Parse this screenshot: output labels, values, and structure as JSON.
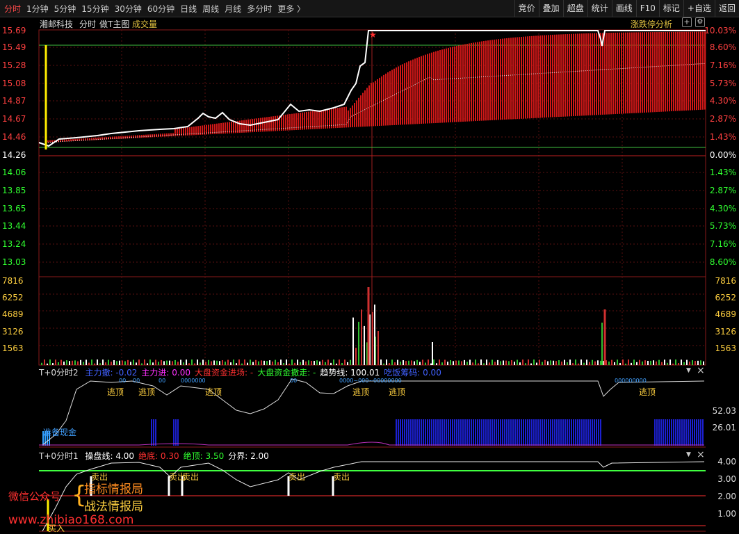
{
  "toolbar": {
    "left": [
      {
        "label": "分时",
        "active": true
      },
      {
        "label": "1分钟"
      },
      {
        "label": "5分钟"
      },
      {
        "label": "15分钟"
      },
      {
        "label": "30分钟"
      },
      {
        "label": "60分钟"
      },
      {
        "label": "日线"
      },
      {
        "label": "周线"
      },
      {
        "label": "月线"
      },
      {
        "label": "多分时"
      },
      {
        "label": "更多 〉"
      }
    ],
    "right": [
      "竞价",
      "叠加",
      "超盘",
      "统计",
      "画线",
      "F10",
      "标记",
      "+自选",
      "返回"
    ]
  },
  "chart_header": {
    "stock_name": "湘邮科技",
    "mode": "分时",
    "template": "做T主图",
    "volume": "成交量",
    "limit_analysis": "涨跌停分析",
    "plus_icon": "+",
    "settings_icon": "⚙"
  },
  "price_axis": {
    "left": [
      "15.69",
      "15.49",
      "15.28",
      "15.08",
      "14.87",
      "14.67",
      "14.46",
      "14.26",
      "14.06",
      "13.85",
      "13.65",
      "13.44",
      "13.24",
      "13.03"
    ],
    "right": [
      "10.03%",
      "8.60%",
      "7.16%",
      "5.73%",
      "4.30%",
      "2.87%",
      "1.43%",
      "0.00%",
      "1.43%",
      "2.87%",
      "4.30%",
      "5.73%",
      "7.16%",
      "8.60%"
    ],
    "up_color": "#ff4040",
    "base_color": "#ffffff",
    "down_color": "#30ff30"
  },
  "volume_axis": {
    "labels": [
      "7816",
      "6252",
      "4689",
      "3126",
      "1563"
    ],
    "color": "#ffd040"
  },
  "indicator2": {
    "title": "T+0分时2",
    "items": [
      {
        "text": "主力撤: -0.02",
        "color": "#4060ff"
      },
      {
        "text": "主力进: 0.00",
        "color": "#ff30ff"
      },
      {
        "text": "大盘资金进场: -",
        "color": "#ff3030"
      },
      {
        "text": "大盘资金撤走: -",
        "color": "#30ff30"
      },
      {
        "text": "趋势线: 100.01",
        "color": "#ffffff"
      },
      {
        "text": "吃饭筹码: 0.00",
        "color": "#4060ff"
      }
    ],
    "axis": [
      "52.03",
      "26.01"
    ],
    "signals": [
      "逃顶",
      "逃顶",
      "逃顶",
      "逃顶",
      "逃顶",
      "逃顶"
    ],
    "cash_label": "准备现金",
    "markers": [
      "00",
      "00",
      "00",
      "0000000",
      "00",
      "0000~000~00000000",
      "000000000"
    ]
  },
  "indicator1": {
    "title": "T+0分时1",
    "items": [
      {
        "text": "操盘线: 4.00",
        "color": "#ffffff"
      },
      {
        "text": "绝底: 0.30",
        "color": "#ff3030"
      },
      {
        "text": "绝顶: 3.50",
        "color": "#30ff30"
      },
      {
        "text": "分界: 2.00",
        "color": "#ffffff"
      }
    ],
    "axis": [
      "4.00",
      "3.00",
      "2.00",
      "1.00"
    ],
    "signals": [
      "卖出",
      "卖出",
      "卖出",
      "卖出",
      "卖出"
    ],
    "buy_label": "买入"
  },
  "watermark": {
    "line1": "微信公众号",
    "brace": "{",
    "line2a": "指标情报局",
    "line2b": "战法情报局",
    "url": "www.zhibiao168.com"
  },
  "panel_controls": {
    "dropdown": "▼",
    "close": "×"
  }
}
